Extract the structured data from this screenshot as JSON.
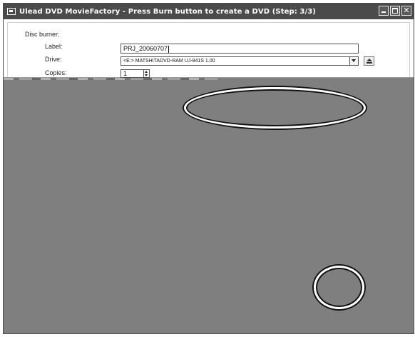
{
  "window": {
    "title": "Ulead DVD MovieFactory - Press Burn button to create a DVD (Step: 3/3)",
    "icon": "dvd-app-icon",
    "controls": [
      "minimize-icon",
      "maximize-icon",
      "close-icon"
    ],
    "close_glyph": "✕"
  },
  "disc_burner": {
    "section_label": "Disc burner:",
    "label_caption": "Label:",
    "label_value": "PRJ_20060707",
    "drive_caption": "Drive:",
    "drive_value": "<E:> MATSHITADVD-RAM UJ-841S  1.00",
    "copies_caption": "Copies:",
    "copies_value": "1",
    "eject_icon": "eject-icon"
  },
  "colors": {
    "titlebar": "#4b4b4b",
    "content_background": "#7f7f7f",
    "panel_background": "#ffffff",
    "annotation_stroke": "#ffffff"
  }
}
